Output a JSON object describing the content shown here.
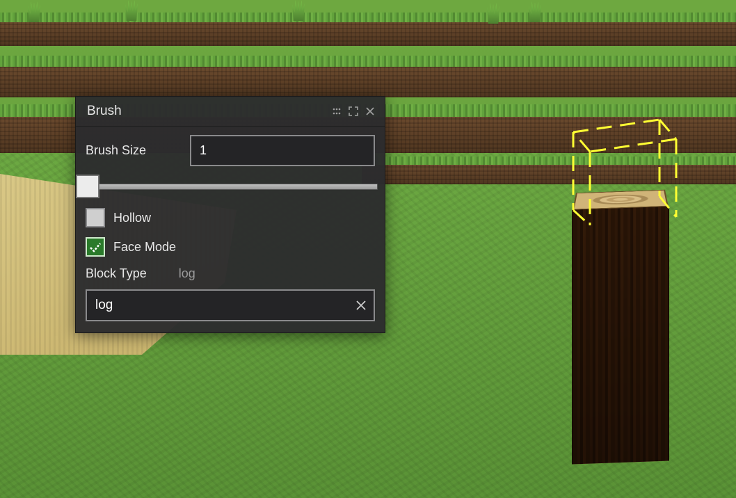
{
  "panel": {
    "title": "Brush",
    "brush_size_label": "Brush Size",
    "brush_size_value": "1",
    "slider_min": 1,
    "slider_max": 32,
    "hollow_label": "Hollow",
    "hollow_checked": false,
    "face_mode_label": "Face Mode",
    "face_mode_checked": true,
    "block_type_label": "Block Type",
    "block_type_current": "log",
    "block_type_input": "log"
  },
  "icons": {
    "drag": "drag-grip-icon",
    "maximize": "expand-icon",
    "close": "close-icon",
    "clear": "clear-icon"
  },
  "colors": {
    "panel_bg": "#2c2c2e",
    "input_border": "#8a8a8c",
    "checked_green": "#2a7a2a",
    "selection_yellow": "#ffff33"
  },
  "world": {
    "placed_block": "log",
    "cursor_block_preview": "log",
    "terrain": "grass_plains_with_dirt_path"
  }
}
